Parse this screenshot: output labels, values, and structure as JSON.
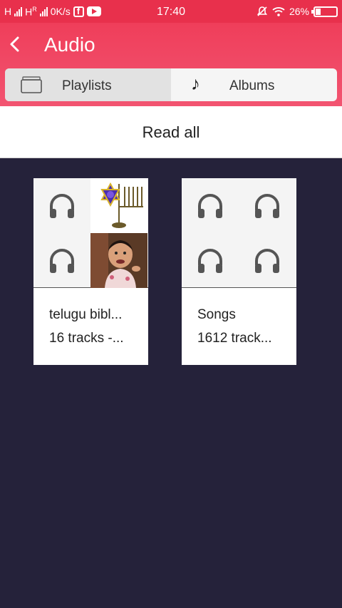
{
  "status_bar": {
    "network1": "H",
    "network2": "H",
    "network2_sup": "R",
    "speed": "0K/s",
    "time": "17:40",
    "battery": "26%",
    "battery_level": 0.26,
    "icons": [
      "signal-icon",
      "facebook-icon",
      "youtube-icon",
      "mute-icon",
      "wifi-icon",
      "battery-icon"
    ]
  },
  "app_bar": {
    "title": "Audio",
    "back_icon": "chevron-left-icon",
    "color": "#ef3e5a"
  },
  "tabs": [
    {
      "label": "Playlists",
      "icon": "folder-icon",
      "active": true
    },
    {
      "label": "Albums",
      "icon": "music-note-icon",
      "active": false
    }
  ],
  "read_all": {
    "label": "Read all"
  },
  "playlists": [
    {
      "name": "telugu bibl...",
      "subtitle": "16 tracks -..."
    },
    {
      "name": "Songs",
      "subtitle": "1612 track..."
    }
  ],
  "colors": {
    "background": "#25223a",
    "accent": "#ef3e5a"
  }
}
